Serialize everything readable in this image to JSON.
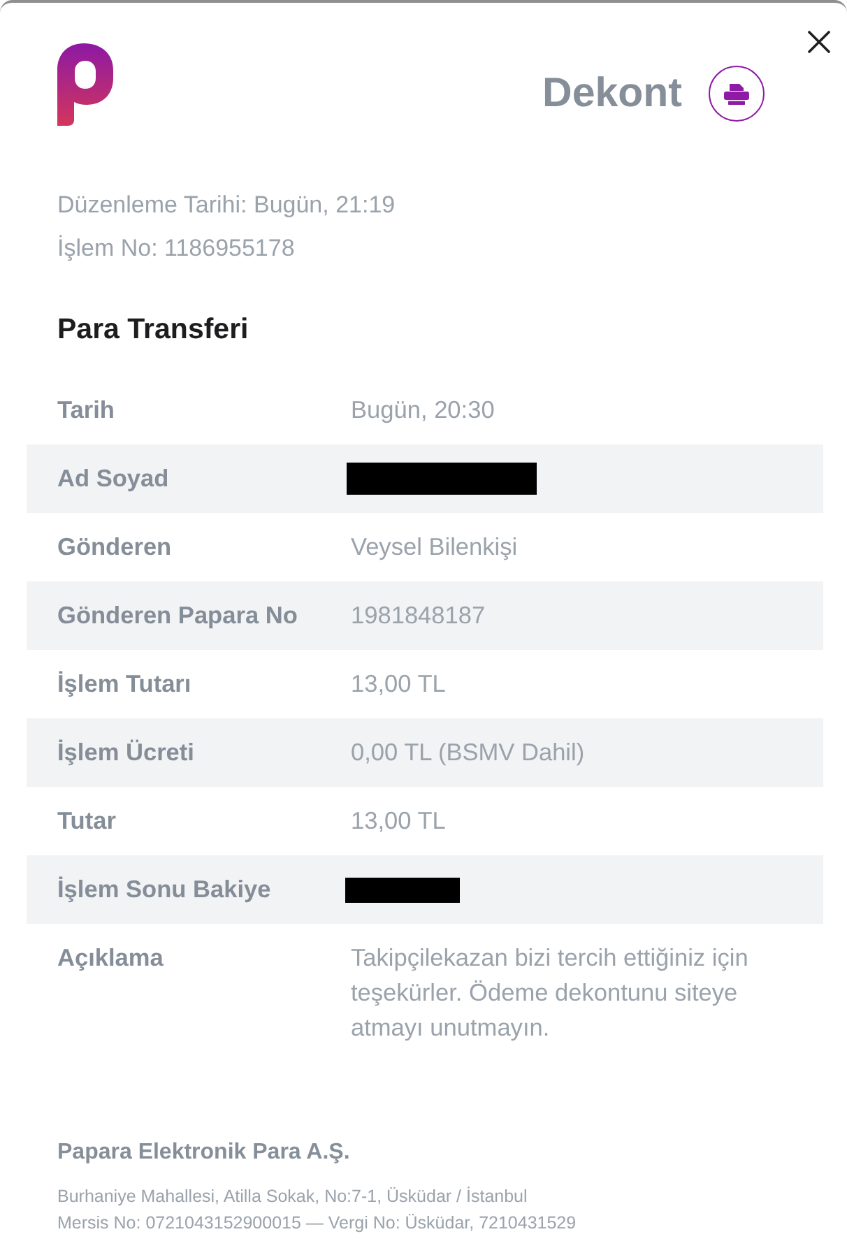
{
  "header": {
    "title": "Dekont"
  },
  "meta": [
    "Düzenleme Tarihi: Bugün, 21:19",
    "İşlem No: 1186955178"
  ],
  "section": {
    "title": "Para Transferi"
  },
  "rows": [
    {
      "label": "Tarih",
      "kind": "text",
      "value": "Bugün, 20:30"
    },
    {
      "label": "Ad Soyad",
      "kind": "redacted_wide"
    },
    {
      "label": "Gönderen",
      "kind": "text",
      "value": "Veysel Bilenkişi"
    },
    {
      "label": "Gönderen Papara No",
      "kind": "text",
      "value": "1981848187"
    },
    {
      "label": "İşlem Tutarı",
      "kind": "text",
      "value": "13,00 TL"
    },
    {
      "label": "İşlem Ücreti",
      "kind": "text",
      "value": "0,00 TL (BSMV Dahil)"
    },
    {
      "label": "Tutar",
      "kind": "text",
      "value": "13,00 TL"
    },
    {
      "label": "İşlem Sonu Bakiye",
      "kind": "redacted_narrow"
    },
    {
      "label": "Açıklama",
      "kind": "text",
      "value": "Takipçilekazan bizi tercih ettiğiniz için teşekürler. Ödeme dekontunu siteye atmayı unutmayın."
    }
  ],
  "footer": {
    "company": "Papara Elektronik Para A.Ş.",
    "address_lines": [
      "Burhaniye Mahallesi, Atilla Sokak, No:7-1, Üsküdar / İstanbul",
      "Mersis No: 0721043152900015 — Vergi No: Üsküdar, 7210431529"
    ]
  }
}
